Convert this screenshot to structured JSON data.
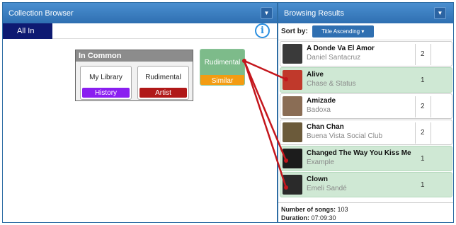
{
  "collection": {
    "title": "Collection Browser",
    "tab_label": "All In",
    "in_common": {
      "title": "In Common",
      "libraries": [
        {
          "name": "My Library",
          "tag": "History",
          "tag_color": "#8a1ff0"
        },
        {
          "name": "Rudimental",
          "tag": "Artist",
          "tag_color": "#b01818"
        }
      ]
    },
    "node": {
      "name": "Rudimental",
      "tag": "Similar"
    }
  },
  "browsing": {
    "title": "Browsing Results",
    "sort_label": "Sort by:",
    "sort_value": "Title Ascending ▾",
    "songs": [
      {
        "title": "A Donde Va El Amor",
        "artist": "Daniel Santacruz",
        "count": "2",
        "highlight": false,
        "thumb": "#3a3a3a"
      },
      {
        "title": "Alive",
        "artist": "Chase & Status",
        "count": "1",
        "highlight": true,
        "thumb": "#c0392b"
      },
      {
        "title": "Amizade",
        "artist": "Badoxa",
        "count": "2",
        "highlight": false,
        "thumb": "#8a6d55"
      },
      {
        "title": "Chan Chan",
        "artist": "Buena Vista Social Club",
        "count": "2",
        "highlight": false,
        "thumb": "#6b5a3a"
      },
      {
        "title": "Changed The Way You Kiss Me",
        "artist": "Example",
        "count": "1",
        "highlight": true,
        "thumb": "#1c1c1c"
      },
      {
        "title": "Clown",
        "artist": "Emeli Sandé",
        "count": "1",
        "highlight": true,
        "thumb": "#2a2a2a"
      }
    ],
    "footer": {
      "songs_label": "Number of songs:",
      "songs_value": "103",
      "duration_label": "Duration:",
      "duration_value": "07:09:30"
    }
  },
  "colors": {
    "link": "#c4161c",
    "header": "#2f6fb1"
  }
}
